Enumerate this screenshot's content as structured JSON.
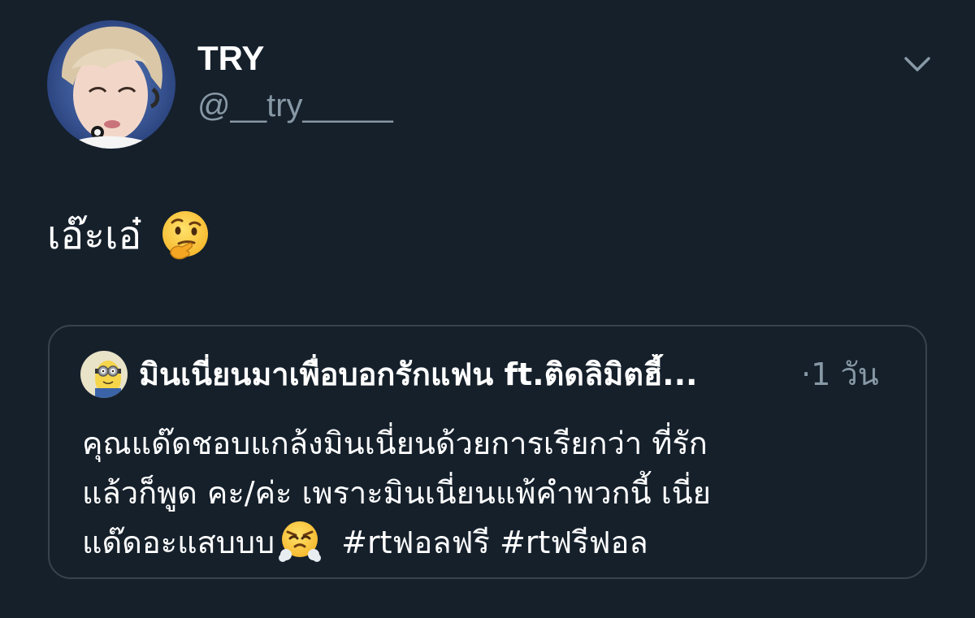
{
  "tweet": {
    "author": {
      "display_name": "TRY",
      "handle": "@__try_____",
      "avatar_icon": "profile-photo"
    },
    "text": "เอ๊ะเอ๋",
    "emoji": "thinking-face-emoji",
    "menu_icon": "chevron-down-icon"
  },
  "quoted_tweet": {
    "author_name": "มินเนี่ยนมาเพื่อบอกรักแฟน ft.ติดลิมิตฮี้...",
    "time": "·1 วัน",
    "avatar_icon": "minion-avatar",
    "lines": [
      "คุณแด๊ดชอบแกล้งมินเนี่ยนด้วยการเรียกว่า ที่รัก",
      "แล้วก็พูด คะ/ค่ะ เพราะมินเนี่ยนแพ้คำพวกนี้ เนี่ย",
      "แด๊ดอะแสบบบ"
    ],
    "emoji": "face-with-steam-emoji",
    "hashtags": [
      "#rtฟอลฟรี",
      "#rtฟรีฟอล"
    ]
  },
  "colors": {
    "background": "#15202b",
    "text_primary": "#ffffff",
    "text_secondary": "#8899a6",
    "border": "#38444d"
  }
}
